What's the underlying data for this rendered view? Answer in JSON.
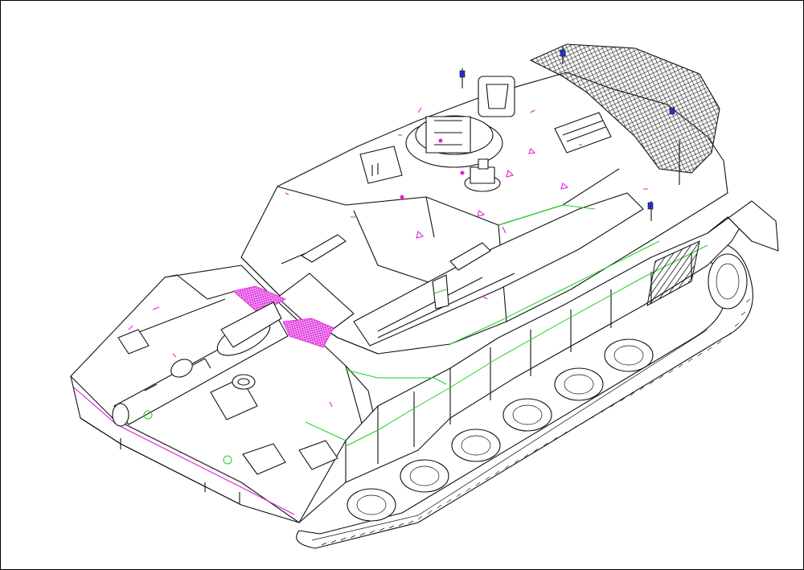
{
  "figure": {
    "background": "#ffffff",
    "outline_color": "#111111",
    "accent_colors": {
      "panels": "#1fd21f",
      "markings": "#e01ee0",
      "lights": "#2233cc"
    }
  }
}
